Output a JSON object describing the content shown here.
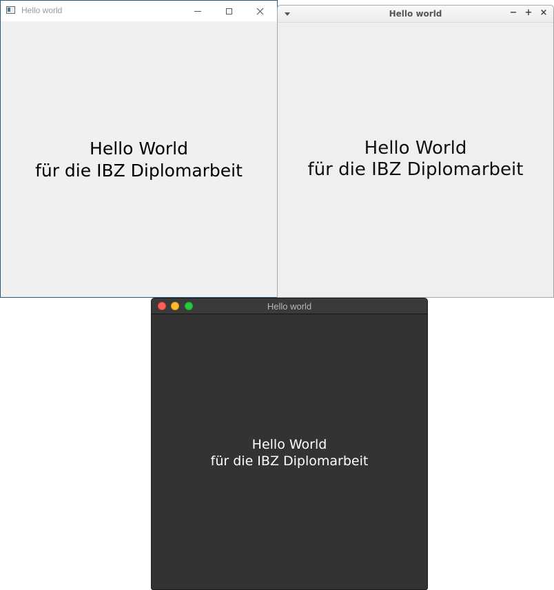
{
  "windows": {
    "windows10": {
      "title": "Hello world",
      "icons": {
        "app": "app-icon",
        "minimize": "minimize-icon",
        "maximize": "maximize-icon",
        "close": "close-icon"
      },
      "content": {
        "line1": "Hello World",
        "line2": "für die IBZ Diplomarbeit"
      },
      "colors": {
        "titlebar": "#ffffff",
        "background": "#f0f0f0",
        "border": "#2b5479"
      }
    },
    "linux": {
      "title": "Hello world",
      "buttons": {
        "minimize": "−",
        "maximize": "+",
        "close": "×"
      },
      "icons": {
        "menu": "menu-triangle-icon"
      },
      "content": {
        "line1": "Hello World",
        "line2": "für die IBZ Diplomarbeit"
      },
      "colors": {
        "background": "#efefef"
      }
    },
    "macos": {
      "title": "Hello world",
      "icons": {
        "close": "traffic-light-close-icon",
        "minimize": "traffic-light-minimize-icon",
        "zoom": "traffic-light-zoom-icon"
      },
      "content": {
        "line1": "Hello World",
        "line2": "für die IBZ Diplomarbeit"
      },
      "colors": {
        "background": "#333333",
        "close": "#fe5f57",
        "minimize": "#febc2e",
        "zoom": "#28c840"
      }
    }
  }
}
